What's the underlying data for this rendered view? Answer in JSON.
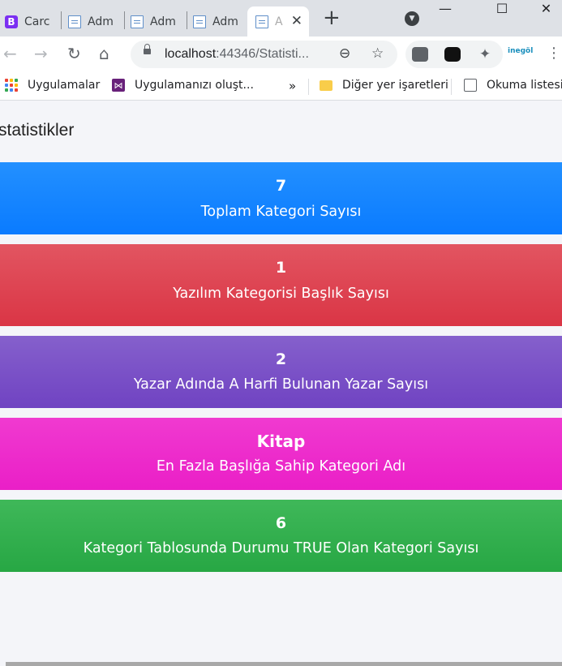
{
  "browser": {
    "tabs": [
      {
        "title": "Carc",
        "favicon": "bootstrap-icon"
      },
      {
        "title": "Adm",
        "favicon": "document-icon"
      },
      {
        "title": "Adm",
        "favicon": "document-icon"
      },
      {
        "title": "Adm",
        "favicon": "document-icon"
      },
      {
        "title": "A",
        "favicon": "document-icon",
        "active": true
      }
    ],
    "new_tab": "+",
    "address": {
      "host": "localhost",
      "rest": ":44346/Statisti..."
    },
    "bookmarks": {
      "apps": "Uygulamalar",
      "vs": "Uygulamanızı oluşt...",
      "more": "»",
      "other": "Diğer yer işaretleri",
      "reading_list": "Okuma listesi"
    }
  },
  "page": {
    "title": "statistikler",
    "cards": [
      {
        "value": "7",
        "label": "Toplam Kategori Sayısı",
        "color": "#0d7fff"
      },
      {
        "value": "1",
        "label": "Yazılım Kategorisi Başlık Sayısı",
        "color": "#dc3545"
      },
      {
        "value": "2",
        "label": "Yazar Adında A Harfi Bulunan Yazar Sayısı",
        "color": "#6f42c1"
      },
      {
        "value": "Kitap",
        "label": "En Fazla Başlığa Sahip Kategori Adı",
        "color": "#e83e8c"
      },
      {
        "value": "6",
        "label": "Kategori Tablosunda Durumu TRUE Olan Kategori Sayısı",
        "color": "#28a745"
      }
    ]
  }
}
